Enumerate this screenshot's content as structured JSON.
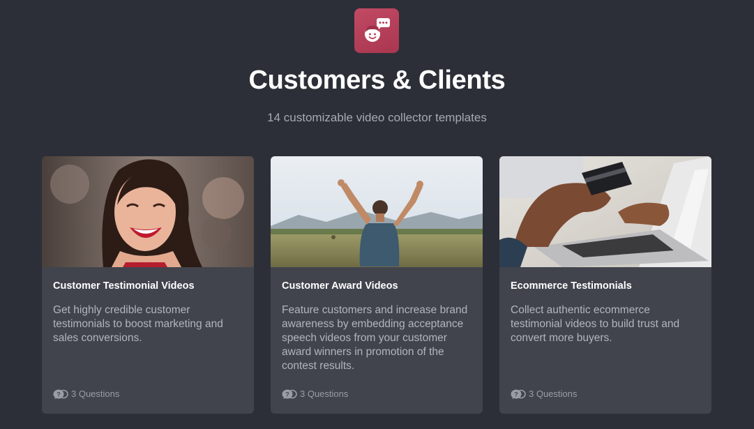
{
  "header": {
    "logo_icon": "customer-chat-icon",
    "title": "Customers & Clients",
    "subtitle": "14 customizable video collector templates"
  },
  "colors": {
    "background": "#2c2f37",
    "card": "#41444d",
    "logo": "#b8415b"
  },
  "cards": [
    {
      "image": "smiling-woman-photo",
      "title": "Customer Testimonial Videos",
      "description": "Get highly credible customer testimonials to boost marketing and sales conversions.",
      "questions_icon": "questions-icon",
      "questions": "3 Questions"
    },
    {
      "image": "man-celebrating-field-photo",
      "title": "Customer Award Videos",
      "description": "Feature customers and increase brand awareness by embedding acceptance speech videos from your customer award winners in promotion of the contest results.",
      "questions_icon": "questions-icon",
      "questions": "3 Questions"
    },
    {
      "image": "credit-card-laptop-photo",
      "title": "Ecommerce Testimonials",
      "description": "Collect authentic ecommerce testimonial videos to build trust and convert more buyers.",
      "questions_icon": "questions-icon",
      "questions": "3 Questions"
    }
  ]
}
